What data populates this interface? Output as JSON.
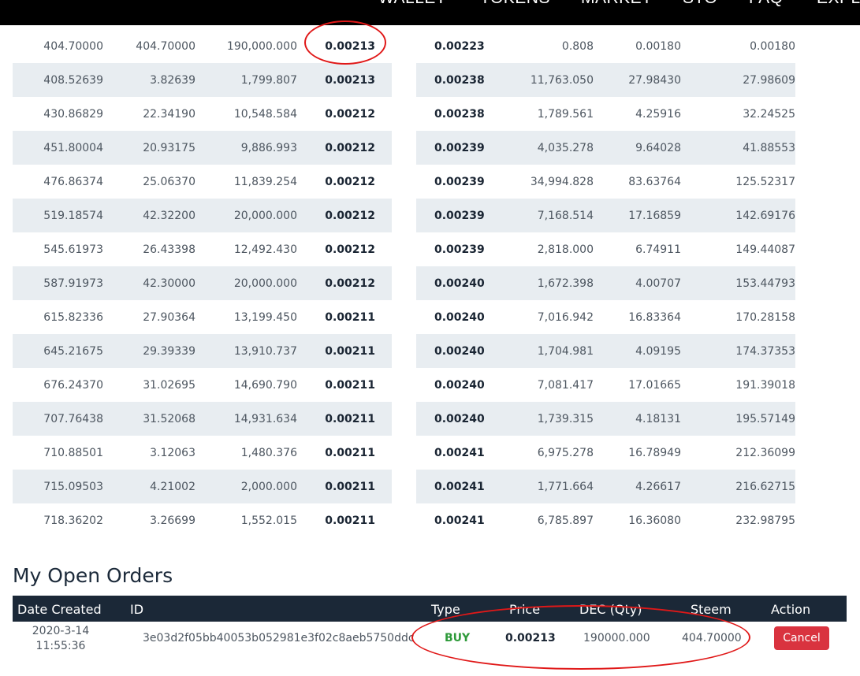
{
  "nav": {
    "items": [
      "WALLET",
      "TOKENS",
      "MARKET",
      "STO",
      "FAQ",
      "EXPL"
    ]
  },
  "bids": [
    [
      "404.70000",
      "404.70000",
      "190,000.000",
      "0.00213"
    ],
    [
      "408.52639",
      "3.82639",
      "1,799.807",
      "0.00213"
    ],
    [
      "430.86829",
      "22.34190",
      "10,548.584",
      "0.00212"
    ],
    [
      "451.80004",
      "20.93175",
      "9,886.993",
      "0.00212"
    ],
    [
      "476.86374",
      "25.06370",
      "11,839.254",
      "0.00212"
    ],
    [
      "519.18574",
      "42.32200",
      "20,000.000",
      "0.00212"
    ],
    [
      "545.61973",
      "26.43398",
      "12,492.430",
      "0.00212"
    ],
    [
      "587.91973",
      "42.30000",
      "20,000.000",
      "0.00212"
    ],
    [
      "615.82336",
      "27.90364",
      "13,199.450",
      "0.00211"
    ],
    [
      "645.21675",
      "29.39339",
      "13,910.737",
      "0.00211"
    ],
    [
      "676.24370",
      "31.02695",
      "14,690.790",
      "0.00211"
    ],
    [
      "707.76438",
      "31.52068",
      "14,931.634",
      "0.00211"
    ],
    [
      "710.88501",
      "3.12063",
      "1,480.376",
      "0.00211"
    ],
    [
      "715.09503",
      "4.21002",
      "2,000.000",
      "0.00211"
    ],
    [
      "718.36202",
      "3.26699",
      "1,552.015",
      "0.00211"
    ]
  ],
  "asks": [
    [
      "0.00223",
      "0.808",
      "0.00180",
      "0.00180"
    ],
    [
      "0.00238",
      "11,763.050",
      "27.98430",
      "27.98609"
    ],
    [
      "0.00238",
      "1,789.561",
      "4.25916",
      "32.24525"
    ],
    [
      "0.00239",
      "4,035.278",
      "9.64028",
      "41.88553"
    ],
    [
      "0.00239",
      "34,994.828",
      "83.63764",
      "125.52317"
    ],
    [
      "0.00239",
      "7,168.514",
      "17.16859",
      "142.69176"
    ],
    [
      "0.00239",
      "2,818.000",
      "6.74911",
      "149.44087"
    ],
    [
      "0.00240",
      "1,672.398",
      "4.00707",
      "153.44793"
    ],
    [
      "0.00240",
      "7,016.942",
      "16.83364",
      "170.28158"
    ],
    [
      "0.00240",
      "1,704.981",
      "4.09195",
      "174.37353"
    ],
    [
      "0.00240",
      "7,081.417",
      "17.01665",
      "191.39018"
    ],
    [
      "0.00240",
      "1,739.315",
      "4.18131",
      "195.57149"
    ],
    [
      "0.00241",
      "6,975.278",
      "16.78949",
      "212.36099"
    ],
    [
      "0.00241",
      "1,771.664",
      "4.26617",
      "216.62715"
    ],
    [
      "0.00241",
      "6,785.897",
      "16.36080",
      "232.98795"
    ]
  ],
  "open_orders": {
    "title": "My Open Orders",
    "headers": {
      "date": "Date Created",
      "id": "ID",
      "type": "Type",
      "price": "Price",
      "qty": "DEC (Qty)",
      "steem": "Steem",
      "action": "Action"
    },
    "row": {
      "date_line1": "2020-3-14",
      "date_line2": "11:55:36",
      "id": "3e03d2f05bb40053b052981e3f02c8aeb5750ddc",
      "type": "BUY",
      "price": "0.00213",
      "qty": "190000.000",
      "steem": "404.70000",
      "action": "Cancel"
    }
  },
  "colors": {
    "nav_bg": "#000000",
    "row_alt": "#e8edf1",
    "header_bg": "#1b2837",
    "buy": "#2e9a3a",
    "cancel": "#d9333f",
    "annotation": "#e01818"
  }
}
